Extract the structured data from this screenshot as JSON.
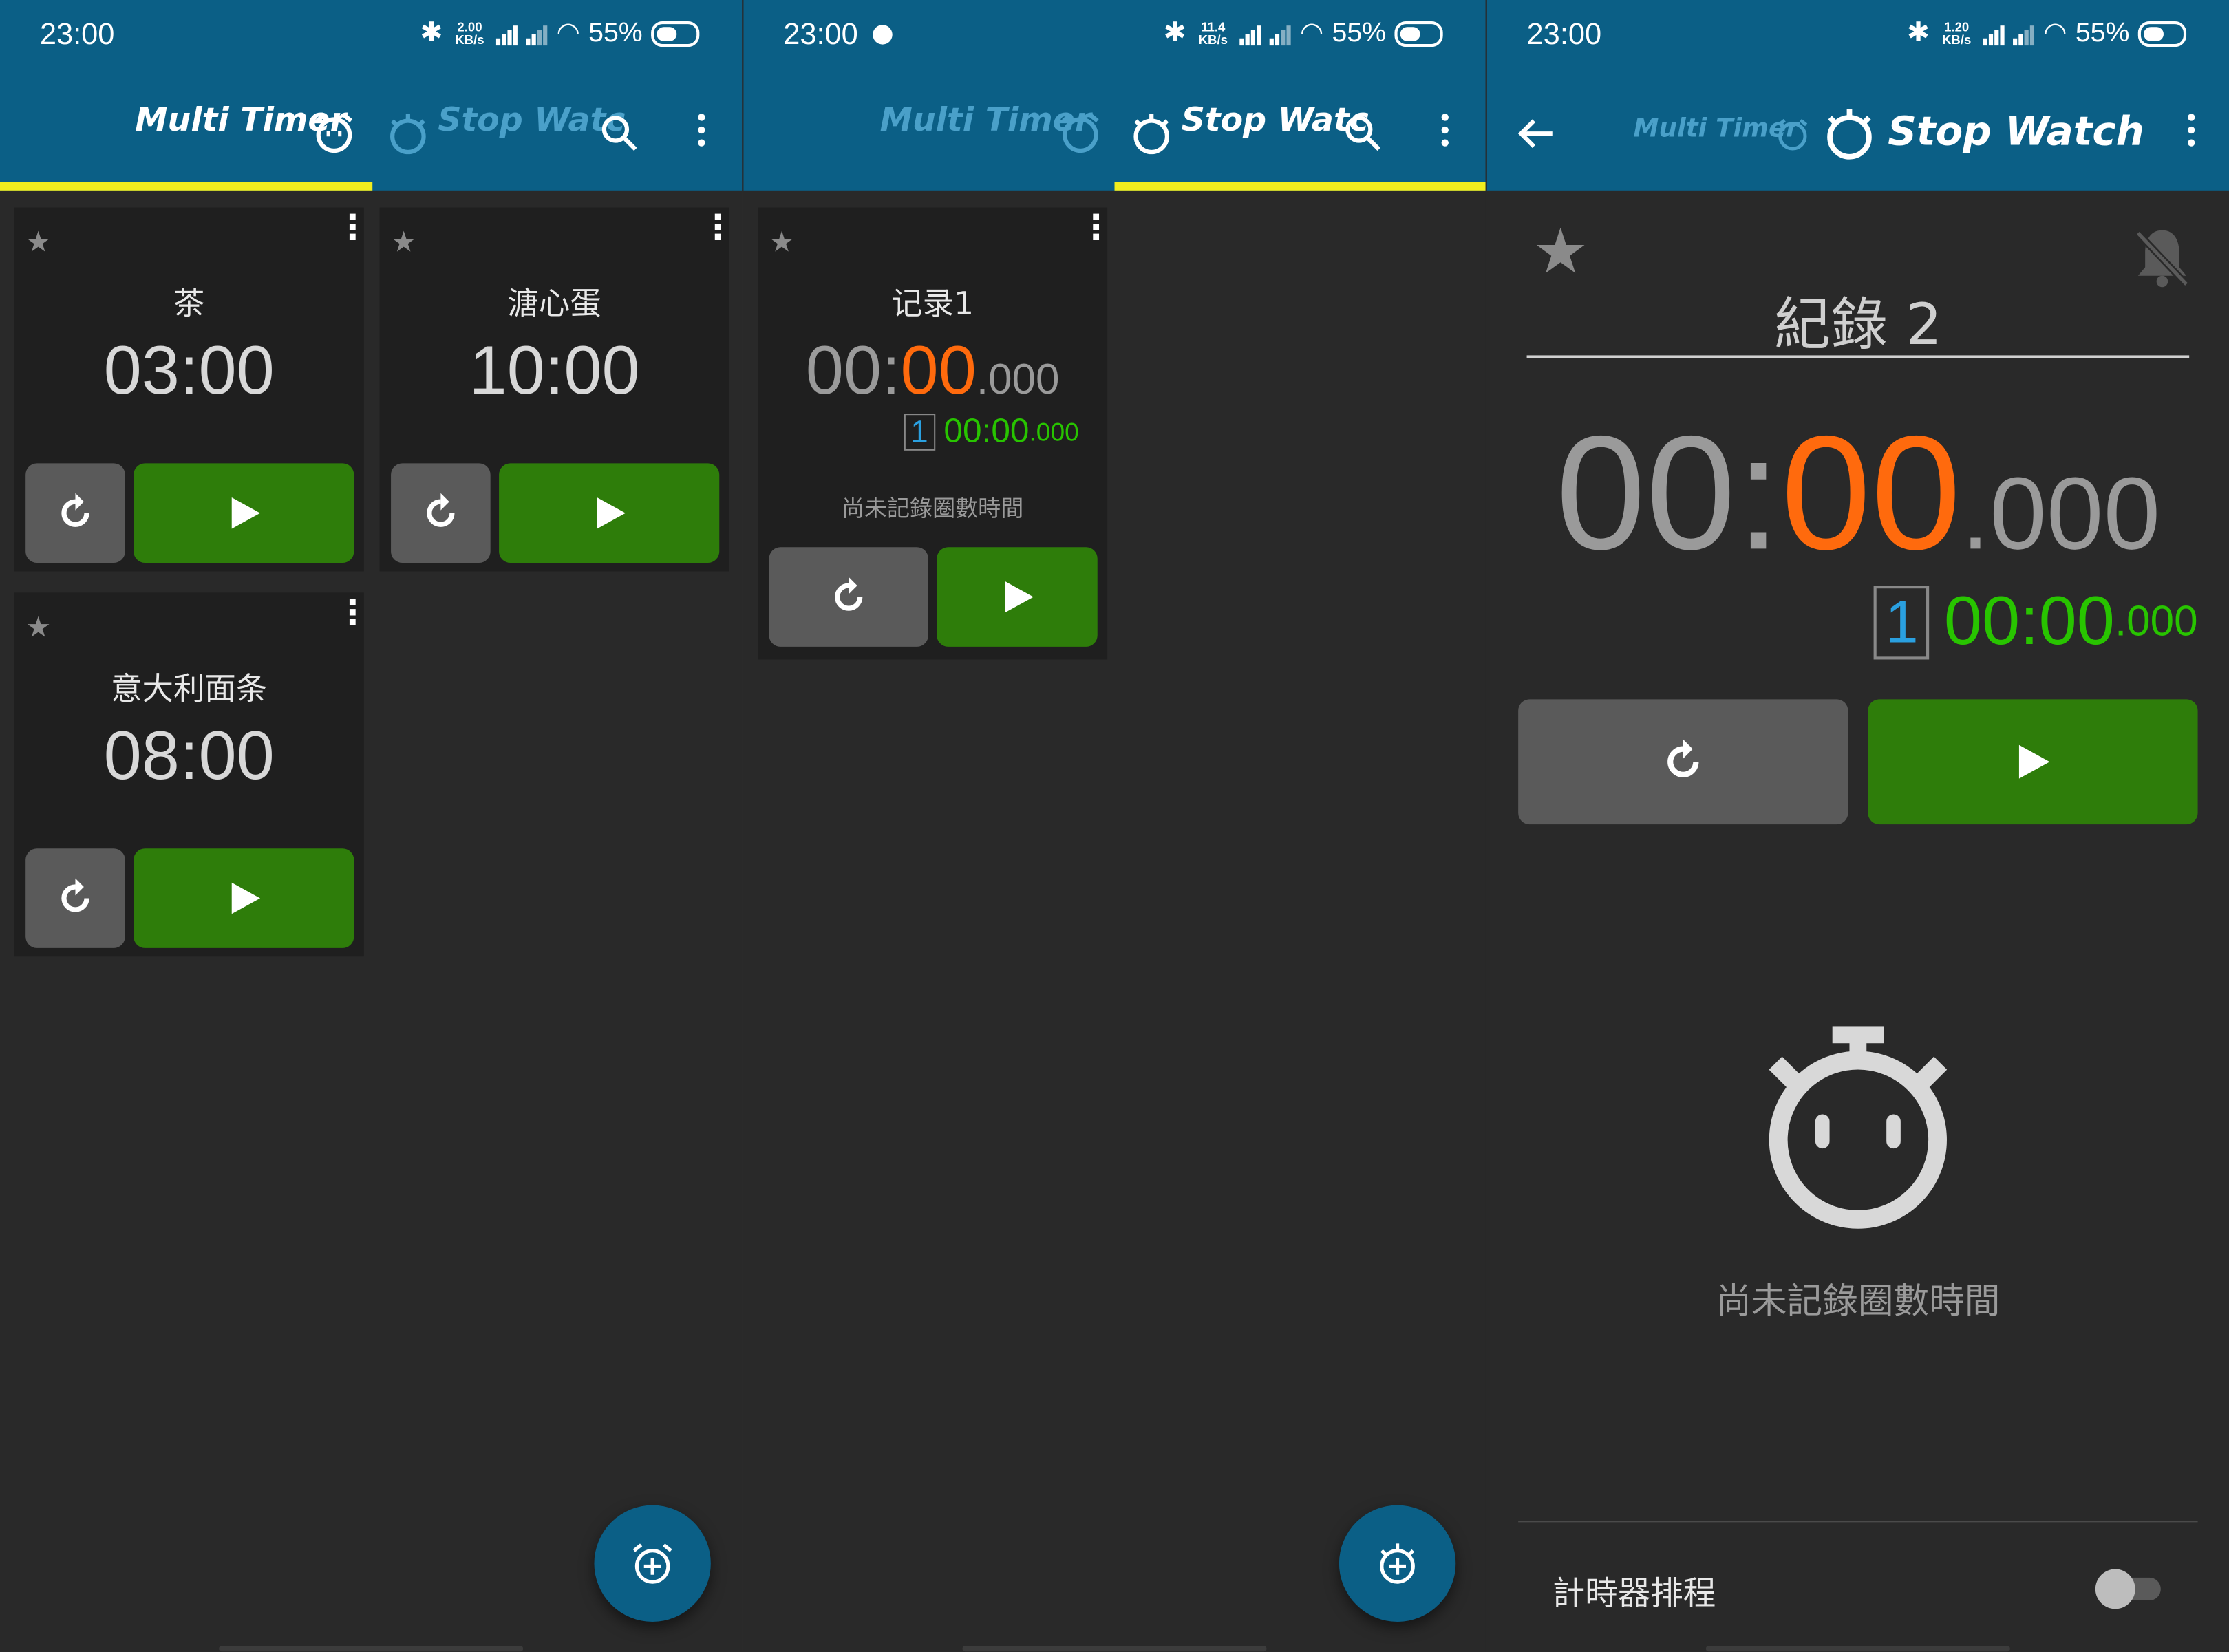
{
  "status_bars": [
    {
      "time": "23:00",
      "net_top": "2.00",
      "net_bottom": "KB/s",
      "battery": "55%",
      "extra_icon": ""
    },
    {
      "time": "23:00",
      "net_top": "11.4",
      "net_bottom": "KB/s",
      "battery": "55%",
      "extra_icon": "wechat-icon"
    },
    {
      "time": "23:00",
      "net_top": "1.20",
      "net_bottom": "KB/s",
      "battery": "55%",
      "extra_icon": ""
    }
  ],
  "tabs": {
    "multi_timer": "Multi Timer",
    "stop_watch_short": "Stop Watc",
    "stop_watch": "Stop Watch"
  },
  "colors": {
    "appbar": "#0b5f86",
    "indicator": "#f2ee1e",
    "play": "#2e7d0a",
    "reset": "#5a5a5a",
    "accent_orange": "#ff6a0d",
    "accent_green": "#28c400"
  },
  "timers": [
    {
      "name": "茶",
      "time": "03:00"
    },
    {
      "name": "溏心蛋",
      "time": "10:00"
    },
    {
      "name": "意大利面条",
      "time": "08:00"
    }
  ],
  "stopwatch_card": {
    "name": "记录1",
    "time_hm": "00:",
    "time_sec": "00",
    "time_ms": ".000",
    "lap_index": "1",
    "lap_time": "00:00",
    "lap_ms": ".000",
    "no_laps": "尚未記錄圈數時間"
  },
  "detail": {
    "name": "紀錄 2",
    "time_hm": "00:",
    "time_sec": "00",
    "time_ms": ".000",
    "lap_index": "1",
    "lap_time": "00:00",
    "lap_ms": ".000",
    "no_laps": "尚未記錄圈數時間",
    "schedule_label": "計時器排程",
    "schedule_enabled": false
  }
}
